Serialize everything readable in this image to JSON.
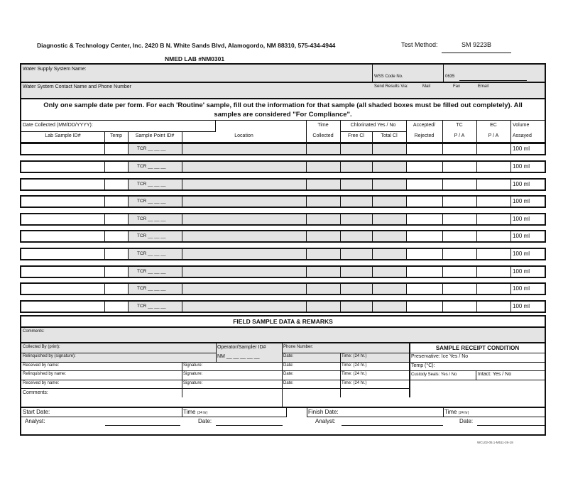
{
  "header": {
    "company_line": "Diagnostic & Technology Center, Inc. 2420 B N. White Sands Blvd, Alamogordo, NM  88310, 575-434-4944",
    "lab_number": "NMED LAB #NM0301",
    "test_method_label": "Test Method:",
    "test_method_value": "SM 9223B"
  },
  "system_info": {
    "water_supply_label": "Water Supply System Name:",
    "wss_code_label": "WSS Code No.",
    "wss_code_value": "0635",
    "contact_label": "Water System Contact Name and Phone Number",
    "send_results_label": "Send Results Via:",
    "send_options": [
      "Mail",
      "Fax",
      "Email"
    ]
  },
  "instructions": {
    "line1": "Only one sample date per form.  For each 'Routine' sample, fill out the information for that sample (all shaded boxes must be filled out completely).  All",
    "line2": "samples are considered \"For Compliance\"."
  },
  "sample_table": {
    "date_collected_label": "Date Collected (MM/DD/YYYY):",
    "headers": {
      "lab_sample_id": "Lab Sample ID#",
      "temp": "Temp",
      "sample_point_id": "Sample Point ID#",
      "location": "Location",
      "time_top": "Time",
      "time_bottom": "Collected",
      "chlorinated": "Chlorinated  Yes  / No",
      "free_cl": "Free Cl",
      "total_cl": "Total Cl",
      "accepted_top": "Accepted/",
      "accepted_bottom": "Rejected",
      "tc_top": "TC",
      "tc_bottom": "P  /  A",
      "ec_top": "EC",
      "ec_bottom": "P  /  A",
      "volume_top": "Volume",
      "volume_bottom": "Assayed"
    },
    "rows": [
      {
        "sample_point": "TCR __ __ __",
        "volume": "100 ml"
      },
      {
        "sample_point": "TCR __ __ __",
        "volume": "100 ml"
      },
      {
        "sample_point": "TCR __ __ __",
        "volume": "100 ml"
      },
      {
        "sample_point": "TCR __ __ __",
        "volume": "100 ml"
      },
      {
        "sample_point": "TCR __ __ __",
        "volume": "100 ml"
      },
      {
        "sample_point": "TCR __ __ __",
        "volume": "100 ml"
      },
      {
        "sample_point": "TCR __ __ __",
        "volume": "100 ml"
      },
      {
        "sample_point": "TCR __ __ __",
        "volume": "100 ml"
      },
      {
        "sample_point": "TCR __ __ __",
        "volume": "100 ml"
      },
      {
        "sample_point": "TCR __ __ __",
        "volume": "100 ml"
      }
    ]
  },
  "field_section": {
    "title": "FIELD SAMPLE DATA & REMARKS",
    "comments_label": "Comments:",
    "collected_by_label": "Collected By (print):",
    "operator_id_label": "Operator/Sampler ID#",
    "operator_id_value": "NM  __ __ __ __ __",
    "phone_label": "Phone Number:",
    "relinquished_sig_label": "Relinquished by (signature):",
    "received_name_label": "Received by name:",
    "relinquished_name_label": "Relinquished by name:",
    "signature_label": "Signature:",
    "date_label": "Date:",
    "time_label": "Time: (24 hr.)",
    "comments2_label": "Comments:"
  },
  "receipt": {
    "title": "SAMPLE RECEIPT CONDITION",
    "preservative": "Preservative:  Ice  Yes  /  No",
    "temp": "Temp (°C):",
    "custody_seals": "Custody Seals: Yes / No",
    "intact": "Intact:   Yes  / No"
  },
  "analysis": {
    "start_date_label": "Start Date:",
    "time_label": "Time",
    "time_unit": "(24 hr)",
    "finish_date_label": "Finish Date:",
    "analyst_label": "Analyst:",
    "date_label": "Date:"
  },
  "footer": {
    "form_code": "WCL02-05.1-M511-26-18"
  }
}
